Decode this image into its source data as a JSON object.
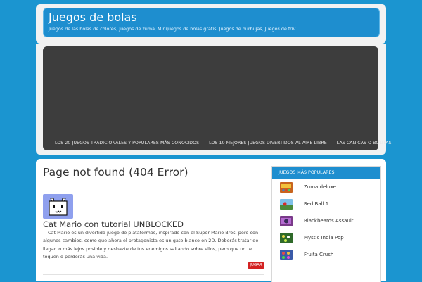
{
  "header": {
    "title": "Juegos de bolas",
    "description": "Juegos de las bolas de colores, Juegos de zuma, Minijuegos de bolas gratis, Juegos de burbujas, Juegos de friv"
  },
  "nav": {
    "items": [
      {
        "label": "LOS 20 JUEGOS TRADICIONALES Y POPULARES MÁS CONOCIDOS"
      },
      {
        "label": "LOS 10 MEJORES JUEGOS DIVERTIDOS AL AIRE LIBRE"
      },
      {
        "label": "LAS CANICAS O BOLITAS"
      }
    ]
  },
  "main": {
    "page_title": "Page not found (404 Error)",
    "post": {
      "title": "Cat Mario con tutorial UNBLOCKED",
      "excerpt": "Cat Mario es un divertido juego de plataformas, inspirado con el Super Mario Bros, pero con algunos cambios, como que ahora el protagonista es un gato blanco en 2D. Deberás tratar de llegar lo más lejos posible y deshazte de tus enemigos saltando sobre ellos, pero que no te toquen o perderás una vida.",
      "button_label": "JUGAR"
    }
  },
  "sidebar": {
    "heading": "JUEGOS MÁS POPULARES",
    "games": [
      {
        "name": "Zuma deluxe",
        "thumb_color": "#c8641e",
        "icon": "zuma-thumbnail-icon"
      },
      {
        "name": "Red Ball 1",
        "thumb_color": "#4a8a3a",
        "icon": "red-ball-thumbnail-icon"
      },
      {
        "name": "Blackbeards Assault",
        "thumb_color": "#7a3a8a",
        "icon": "blackbeards-thumbnail-icon"
      },
      {
        "name": "Mystic India Pop",
        "thumb_color": "#2f6a2a",
        "icon": "mystic-india-thumbnail-icon"
      },
      {
        "name": "Fruita Crush",
        "thumb_color": "#3a5aa8",
        "icon": "fruita-crush-thumbnail-icon"
      }
    ]
  },
  "colors": {
    "background": "#1b95d0",
    "header_blue": "#1e8ecf",
    "banner_dark": "#3d3d3d",
    "button_red": "#d32222"
  }
}
